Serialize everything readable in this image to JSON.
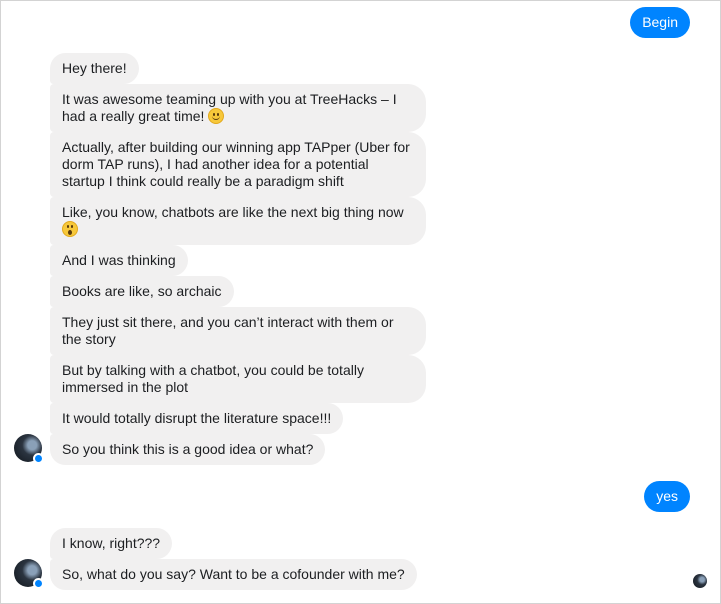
{
  "conversation": {
    "outgoing": [
      {
        "text": "Begin"
      },
      {
        "text": "yes"
      }
    ],
    "incoming_group_1": [
      {
        "text": "Hey there!"
      },
      {
        "text": "It was awesome teaming up with you at TreeHacks – I had a really great time!",
        "emoji": "slightly-smiling-face-icon"
      },
      {
        "text": "Actually, after building our winning app TAPper (Uber for dorm TAP runs), I had another idea for a potential startup I think could really be a paradigm shift"
      },
      {
        "text": "Like, you know, chatbots are like the next big thing now",
        "emoji": "astonished-face-icon"
      },
      {
        "text": "And I was thinking"
      },
      {
        "text": "Books are like, so archaic"
      },
      {
        "text": "They just sit there, and you can’t interact with them or the story"
      },
      {
        "text": "But by talking with a chatbot, you could be totally immersed in the plot"
      },
      {
        "text": "It would totally disrupt the literature space!!!"
      },
      {
        "text": "So you think this is a good idea or what?"
      }
    ],
    "incoming_group_2": [
      {
        "text": "I know, right???"
      },
      {
        "text": "So, what do you say? Want to be a cofounder with me?"
      }
    ],
    "colors": {
      "outgoing_bubble": "#0084ff",
      "incoming_bubble": "#f1f0f0",
      "text": "#1c1e21",
      "messenger_badge": "#0084ff"
    }
  }
}
